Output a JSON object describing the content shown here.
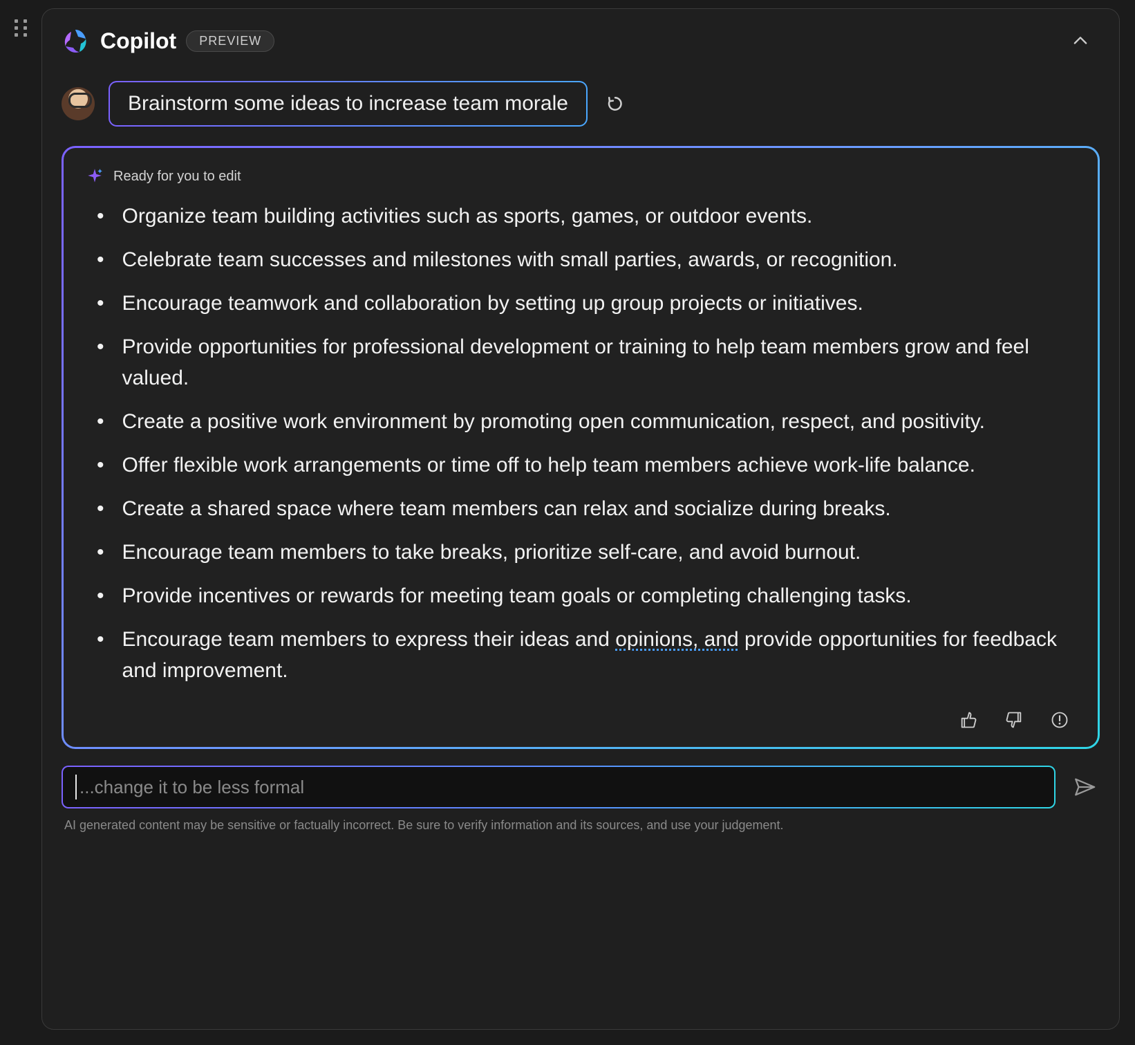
{
  "header": {
    "title": "Copilot",
    "badge": "PREVIEW"
  },
  "prompt": {
    "text": "Brainstorm some ideas to increase team morale"
  },
  "response": {
    "ready_label": "Ready for you to edit",
    "ideas": [
      "Organize team building activities such as sports, games, or outdoor events.",
      "Celebrate team successes and milestones with small parties, awards, or recognition.",
      "Encourage teamwork and collaboration by setting up group projects or initiatives.",
      "Provide opportunities for professional development or training to help team members grow and feel valued.",
      "Create a positive work environment by promoting open communication, respect, and positivity.",
      "Offer flexible work arrangements or time off to help team members achieve work-life balance.",
      "Create a shared space where team members can relax and socialize during breaks.",
      "Encourage team members to take breaks, prioritize self-care, and avoid burnout.",
      "Provide incentives or rewards for meeting team goals or completing challenging tasks."
    ],
    "last_idea": {
      "pre": "Encourage team members to express their ideas and ",
      "underlined": "opinions, and",
      "post": " provide opportunities for feedback and improvement."
    }
  },
  "input": {
    "placeholder": "...change it to be less formal"
  },
  "disclaimer": "AI generated content may be sensitive or factually incorrect. Be sure to verify information and its sources, and use your judgement."
}
